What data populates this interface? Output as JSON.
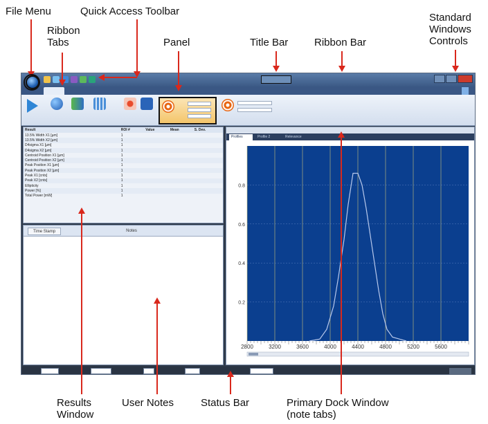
{
  "callouts": {
    "file_menu": "File Menu",
    "quick_access_toolbar": "Quick Access Toolbar",
    "ribbon_tabs": "Ribbon\nTabs",
    "panel": "Panel",
    "title_bar": "Title Bar",
    "ribbon_bar": "Ribbon Bar",
    "standard_windows_controls": "Standard\nWindows\nControls",
    "results_window": "Results\nWindow",
    "user_notes": "User Notes",
    "status_bar": "Status Bar",
    "primary_dock_window": "Primary Dock Window\n(note tabs)"
  },
  "colors": {
    "callout_arrow": "#d9281c",
    "plot_background": "#0b3f8f",
    "plot_curve": "#b9c9ec",
    "ribbon_highlight": "#f4c56b"
  },
  "results": {
    "columns": [
      "Result",
      "ROI #",
      "Value",
      "Mean",
      "S. Dev."
    ],
    "rows": [
      [
        "13.5% Width X1 [µm]",
        "1",
        "",
        "",
        ""
      ],
      [
        "13.5% Width X2 [µm]",
        "1",
        "",
        "",
        ""
      ],
      [
        "D4sigma X1 [µm]",
        "1",
        "",
        "",
        ""
      ],
      [
        "D4sigma X2 [µm]",
        "1",
        "",
        "",
        ""
      ],
      [
        "Centroid Position X1 [µm]",
        "1",
        "",
        "",
        ""
      ],
      [
        "Centroid Position X2 [µm]",
        "1",
        "",
        "",
        ""
      ],
      [
        "Peak Position X1 [µm]",
        "1",
        "",
        "",
        ""
      ],
      [
        "Peak Position X2 [µm]",
        "1",
        "",
        "",
        ""
      ],
      [
        "Peak X1 [cnts]",
        "1",
        "",
        "",
        ""
      ],
      [
        "Peak X2 [cnts]",
        "1",
        "",
        "",
        ""
      ],
      [
        "Ellipticity",
        "1",
        "",
        "",
        ""
      ],
      [
        "Power [%]",
        "1",
        "",
        "",
        ""
      ],
      [
        "Total Power [mW]",
        "1",
        "",
        "",
        ""
      ]
    ]
  },
  "notes": {
    "time_stamp_button": "Time Stamp",
    "notes_header": "Notes",
    "line1": "",
    "line2": ""
  },
  "dock": {
    "tabs": [
      "Profiles",
      "Profile 2",
      "Relevance"
    ],
    "readout": ""
  },
  "chart_data": {
    "type": "line",
    "xlim": [
      2800,
      6000
    ],
    "ylim": [
      0,
      1.0
    ],
    "x_ticks": [
      "2800",
      "3200",
      "3600",
      "4000",
      "4400",
      "4800",
      "5200",
      "5600"
    ],
    "y_ticks": [
      "0.2",
      "0.4",
      "0.6",
      "0.8"
    ],
    "grid": true,
    "series": [
      {
        "x": [
          3700,
          3850,
          3950,
          4050,
          4120,
          4200,
          4260,
          4330,
          4400,
          4460,
          4520,
          4580,
          4640,
          4700,
          4760,
          4820,
          4900,
          5000,
          5100
        ],
        "y": [
          0.0,
          0.01,
          0.06,
          0.18,
          0.33,
          0.52,
          0.7,
          0.86,
          0.86,
          0.8,
          0.68,
          0.54,
          0.4,
          0.26,
          0.14,
          0.06,
          0.02,
          0.01,
          0.0
        ]
      }
    ]
  }
}
